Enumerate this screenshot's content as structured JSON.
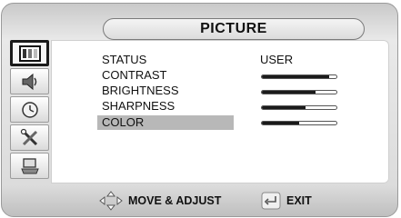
{
  "header": {
    "title": "PICTURE"
  },
  "sidebar": {
    "items": [
      {
        "icon": "picture-icon",
        "active": true
      },
      {
        "icon": "speaker-icon",
        "active": false
      },
      {
        "icon": "clock-icon",
        "active": false
      },
      {
        "icon": "tools-icon",
        "active": false
      },
      {
        "icon": "input-source-icon",
        "active": false
      }
    ]
  },
  "menu": {
    "rows": [
      {
        "label": "STATUS",
        "value": "USER"
      },
      {
        "label": "CONTRAST",
        "level": 0.9
      },
      {
        "label": "BRIGHTNESS",
        "level": 0.72
      },
      {
        "label": "SHARPNESS",
        "level": 0.58
      },
      {
        "label": "COLOR",
        "level": 0.5,
        "selected": true
      }
    ]
  },
  "footer": {
    "move_label": "MOVE & ADJUST",
    "exit_label": "EXIT"
  }
}
